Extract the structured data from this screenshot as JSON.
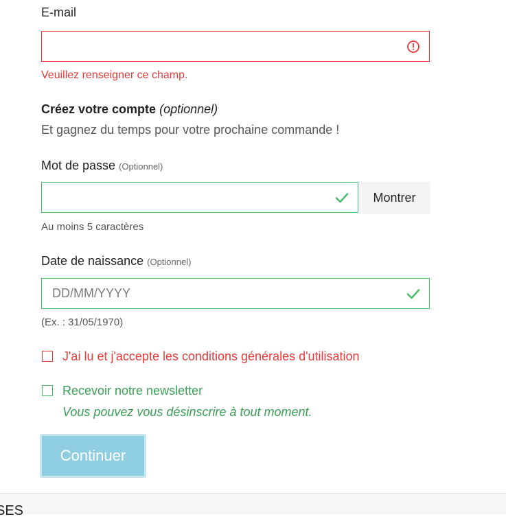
{
  "email": {
    "label": "E-mail",
    "value": "",
    "error": "Veuillez renseigner ce champ."
  },
  "account": {
    "title": "Créez votre compte",
    "title_suffix": "(optionnel)",
    "subtitle": "Et gagnez du temps pour votre prochaine commande !"
  },
  "password": {
    "label": "Mot de passe",
    "optional": "(Optionnel)",
    "value": "",
    "show_button": "Montrer",
    "hint": "Au moins 5 caractères"
  },
  "birthdate": {
    "label": "Date de naissance",
    "optional": "(Optionnel)",
    "placeholder": "DD/MM/YYYY",
    "hint": "(Ex. : 31/05/1970)"
  },
  "terms": {
    "label": "J'ai lu et j'accepte les conditions générales d'utilisation",
    "checked": false
  },
  "newsletter": {
    "label": "Recevoir notre newsletter",
    "note": "Vous pouvez vous désinscrire à tout moment.",
    "checked": false
  },
  "continue_button": "Continuer",
  "next_section_partial": "SES",
  "colors": {
    "error": "#e63939",
    "success": "#4cbb6c",
    "button": "#8fcde0"
  }
}
